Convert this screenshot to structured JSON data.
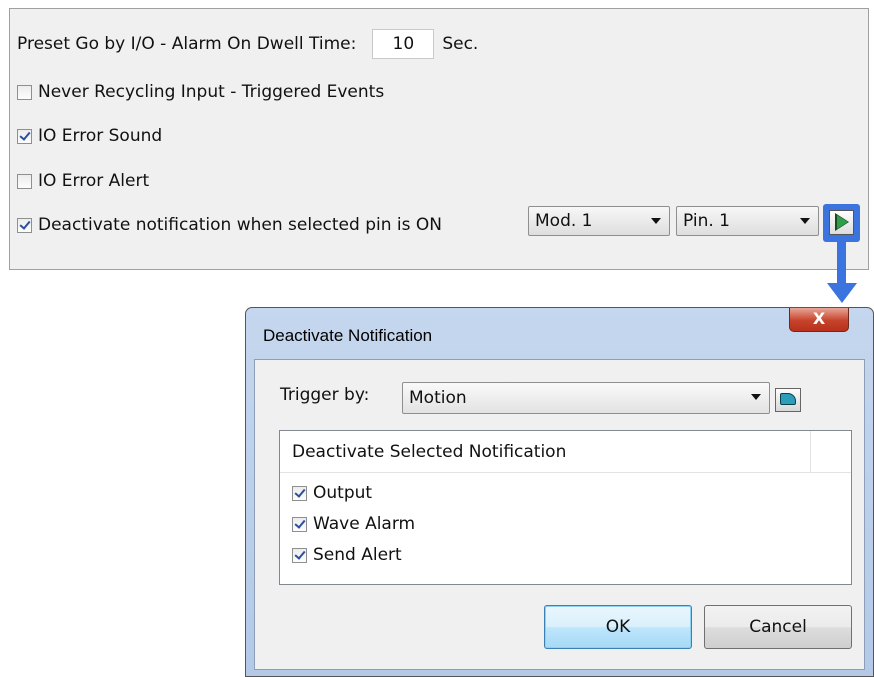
{
  "settings": {
    "dwell_label": "Preset Go by I/O - Alarm On Dwell Time:",
    "dwell_value": "10",
    "dwell_unit": "Sec.",
    "never_recycling": {
      "label": "Never Recycling Input - Triggered Events",
      "checked": false
    },
    "io_error_sound": {
      "label": "IO Error Sound",
      "checked": true
    },
    "io_error_alert": {
      "label": "IO Error Alert",
      "checked": false
    },
    "deactivate_notification": {
      "label": "Deactivate notification when selected pin is ON",
      "checked": true
    },
    "module_select": "Mod. 1",
    "pin_select": "Pin. 1",
    "play_icon": "play-icon"
  },
  "dialog": {
    "title": "Deactivate Notification",
    "close_label": "X",
    "trigger_label": "Trigger by:",
    "trigger_value": "Motion",
    "list_header": "Deactivate Selected Notification",
    "items": [
      {
        "label": "Output",
        "checked": true
      },
      {
        "label": "Wave Alarm",
        "checked": true
      },
      {
        "label": "Send Alert",
        "checked": true
      }
    ],
    "ok_label": "OK",
    "cancel_label": "Cancel"
  },
  "colors": {
    "highlight": "#3b73df",
    "panel": "#f0f0f0",
    "dialog_frame": "#b3c9e6"
  }
}
